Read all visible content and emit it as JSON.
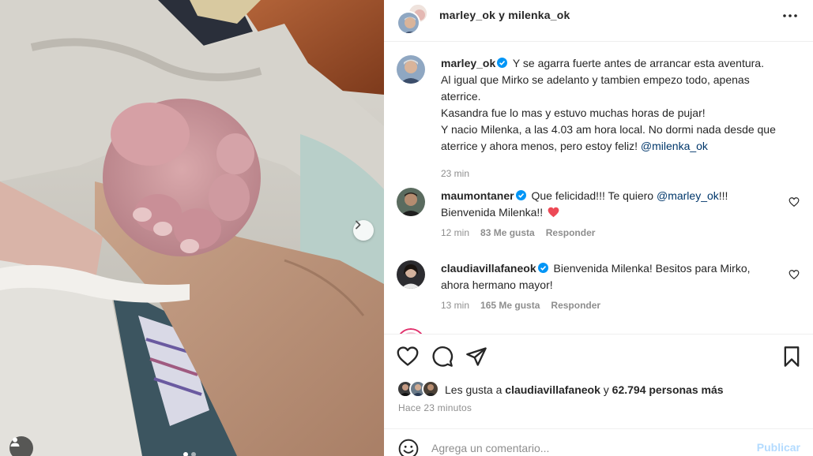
{
  "post": {
    "header": {
      "title": "marley_ok y milenka_ok",
      "more_icon": "more-horizontal-icon"
    },
    "caption": {
      "username": "marley_ok",
      "lines": [
        "Y se agarra fuerte antes de arrancar esta aventura.",
        "Al igual que Mirko se adelanto y tambien empezo todo, apenas aterrice.",
        "Kasandra fue lo mas y estuvo muchas horas de pujar!",
        "Y nacio Milenka, a las 4.03 am hora local. No dormi nada desde que aterrice y ahora menos, pero estoy feliz!"
      ],
      "mention": "@milenka_ok",
      "time": "23 min"
    },
    "comments": [
      {
        "username": "maumontaner",
        "text_before": "Que felicidad!!! Te quiero ",
        "mention": "@marley_ok",
        "text_after": "!!!",
        "line2": "Bienvenida Milenka!!",
        "time": "12 min",
        "likes": "83 Me gusta",
        "reply": "Responder"
      },
      {
        "username": "claudiavillafaneok",
        "text": "Bienvenida Milenka! Besitos para Mirko, ahora hermano mayor!",
        "time": "13 min",
        "likes": "165 Me gusta",
        "reply": "Responder"
      }
    ],
    "likes_summary": {
      "prefix": "Les gusta a ",
      "user": "claudiavillafaneok",
      "middle": " y ",
      "count": "62.794 personas más"
    },
    "time_ago": "Hace 23 minutos",
    "comment_box": {
      "placeholder": "Agrega un comentario...",
      "post_label": "Publicar"
    },
    "carousel": {
      "slides": 2,
      "active_slide": 1
    },
    "colors": {
      "verified": "#0095f6",
      "mention": "#00376b",
      "heart_red": "#ed4956",
      "muted": "#8e8e8e",
      "post_disabled": "#b3dbff"
    }
  }
}
